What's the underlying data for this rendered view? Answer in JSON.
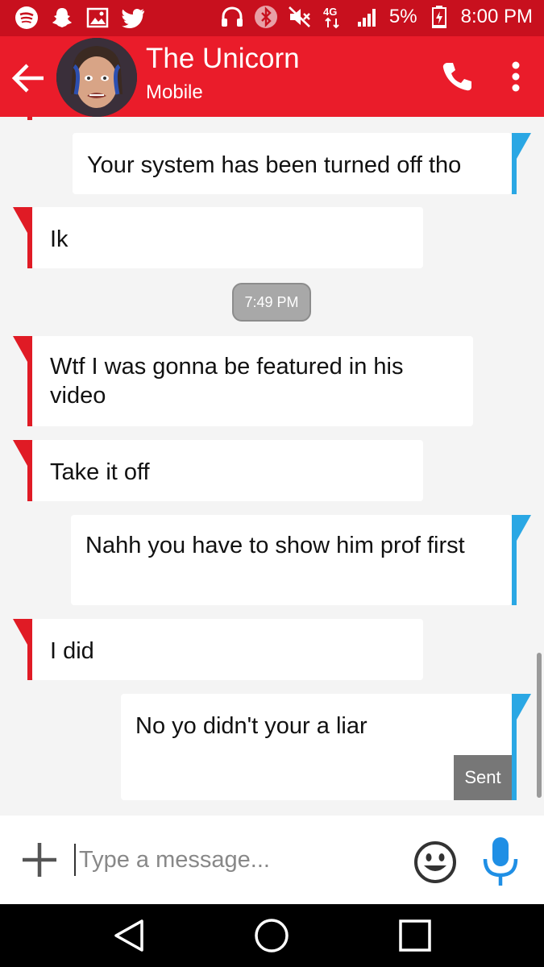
{
  "status_bar": {
    "left_icons": [
      "spotify-icon",
      "snapchat-icon",
      "gallery-icon",
      "twitter-icon"
    ],
    "right_icons": [
      "headset-icon",
      "bluetooth-icon",
      "mute-icon",
      "lte-icon",
      "signal-icon"
    ],
    "network": "4G",
    "battery": "5%",
    "time": "8:00 PM"
  },
  "app_bar": {
    "contact_name": "The Unicorn",
    "contact_subtitle": "Mobile",
    "icons": [
      "back-arrow-icon",
      "phone-icon",
      "more-vert-icon"
    ],
    "color": "#ea1c2a"
  },
  "thread": {
    "messages": [
      {
        "direction": "outgoing",
        "text": "Your system has been turned off tho"
      },
      {
        "direction": "incoming",
        "text": "Ik"
      },
      {
        "direction": "incoming",
        "text": "Wtf I was gonna be featured in his video"
      },
      {
        "direction": "incoming",
        "text": "Take it off"
      },
      {
        "direction": "outgoing",
        "text": "Nahh you have to show him prof first"
      },
      {
        "direction": "incoming",
        "text": "I did"
      },
      {
        "direction": "outgoing",
        "text": "No yo didn't your a liar",
        "status": "Sent"
      }
    ],
    "timestamp": "7:49 PM",
    "incoming_color": "#e01b25",
    "outgoing_color": "#2aa7e4"
  },
  "composer": {
    "placeholder": "Type a message...",
    "icons": [
      "add-icon",
      "emoji-icon",
      "microphone-icon"
    ]
  },
  "nav_bar": {
    "icons": [
      "back-nav-icon",
      "home-nav-icon",
      "recents-nav-icon"
    ]
  }
}
